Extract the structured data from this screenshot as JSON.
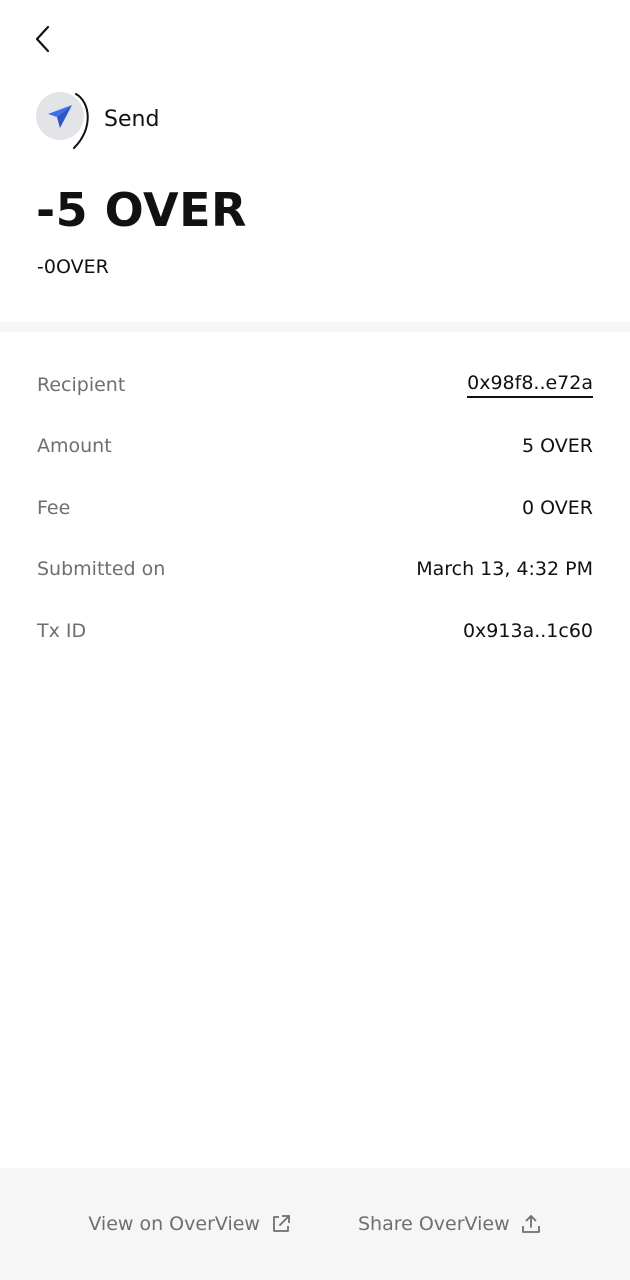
{
  "transaction": {
    "type_label": "Send",
    "amount_display": "-5 OVER",
    "fee_display": "-0OVER"
  },
  "details": [
    {
      "label": "Recipient",
      "value": "0x98f8..e72a",
      "link": true
    },
    {
      "label": "Amount",
      "value": "5 OVER",
      "link": false
    },
    {
      "label": "Fee",
      "value": "0 OVER",
      "link": false
    },
    {
      "label": "Submitted on",
      "value": "March 13, 4:32 PM",
      "link": false
    },
    {
      "label": "Tx ID",
      "value": "0x913a..1c60",
      "link": false
    }
  ],
  "footer": {
    "view_label": "View on OverView",
    "share_label": "Share OverView"
  },
  "icons": {
    "back": "chevron-left-icon",
    "send": "paper-plane-icon",
    "external": "external-link-icon",
    "share": "share-upload-icon"
  },
  "colors": {
    "accent": "#3d6fe6",
    "muted_text": "#6e6e73",
    "footer_bg": "#f6f6f7",
    "icon_circle": "#e2e4e8"
  }
}
